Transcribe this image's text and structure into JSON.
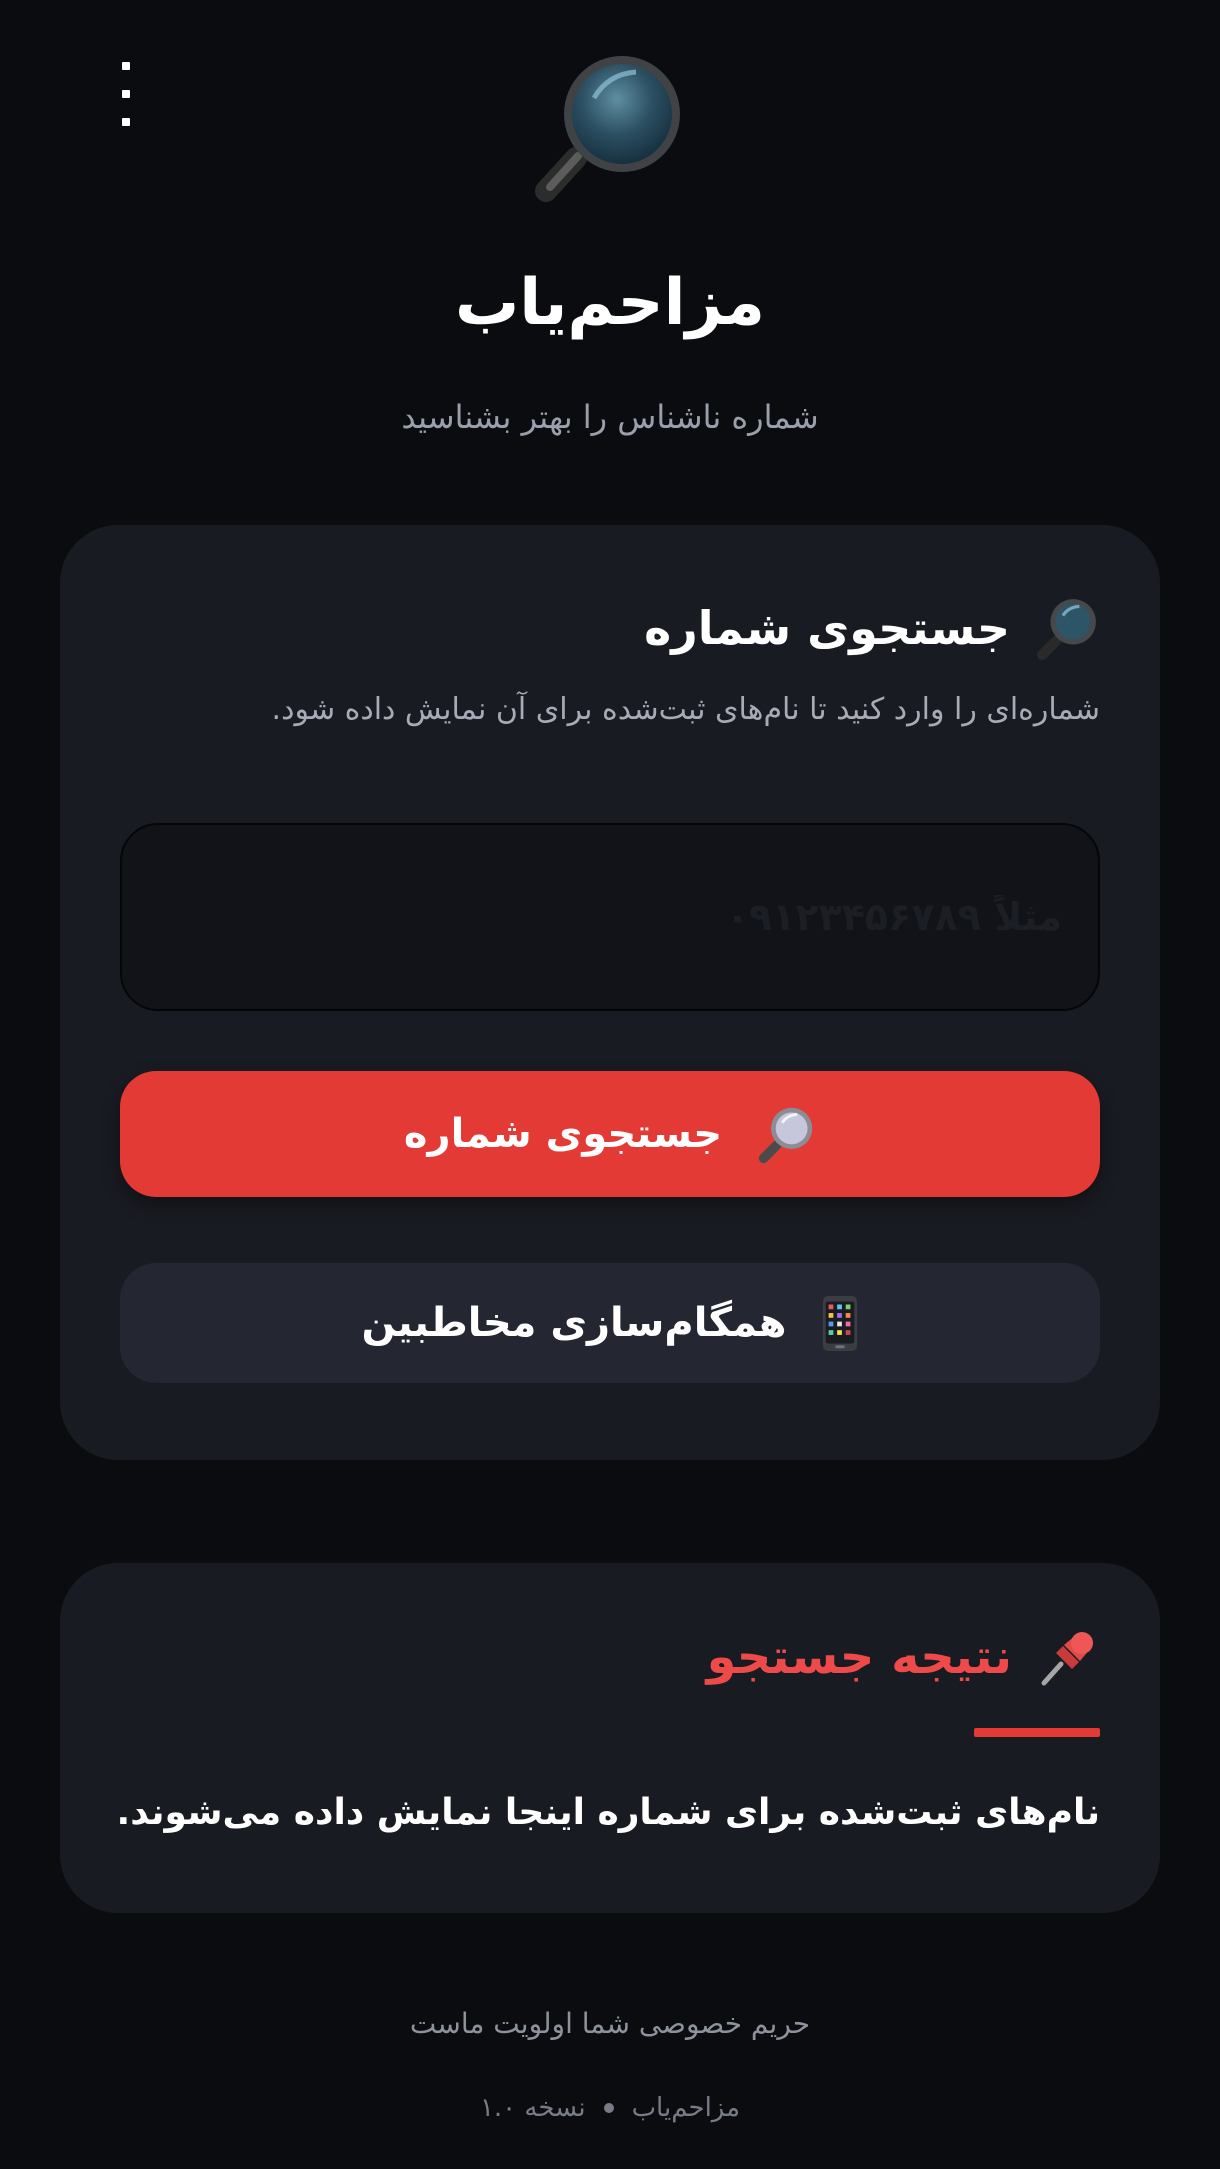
{
  "header": {
    "menu_icon": "more-vertical-icon",
    "logo_icon": "magnifying-glass-icon",
    "title": "مزاحم‌یاب",
    "subtitle": "شماره ناشناس را بهتر بشناسید"
  },
  "search_card": {
    "heading_icon": "magnifying-glass-icon",
    "heading": "جستجوی شماره",
    "description": "شماره‌ای را وارد کنید تا نام‌های ثبت‌شده برای آن نمایش داده شود.",
    "input": {
      "value": "",
      "placeholder": "مثلاً ۰۹۱۲۳۴۵۶۷۸۹"
    },
    "search_button": {
      "icon": "magnifying-glass-icon",
      "label": "جستجوی شماره"
    },
    "sync_button": {
      "icon": "mobile-phone-icon",
      "label": "همگام‌سازی مخاطبین"
    }
  },
  "result_card": {
    "heading_icon": "pushpin-icon",
    "heading": "نتیجه جستجو",
    "message": "نام‌های ثبت‌شده برای شماره اینجا نمایش داده می‌شوند."
  },
  "footer": {
    "privacy": "حریم خصوصی شما اولویت ماست",
    "app_name": "مزاحم‌یاب",
    "version": "نسخه ۱.۰"
  },
  "colors": {
    "background": "#0b0c10",
    "card": "#191b22",
    "accent": "#e33a35",
    "secondary_button": "#242631",
    "muted_text": "#9aa0ab"
  }
}
